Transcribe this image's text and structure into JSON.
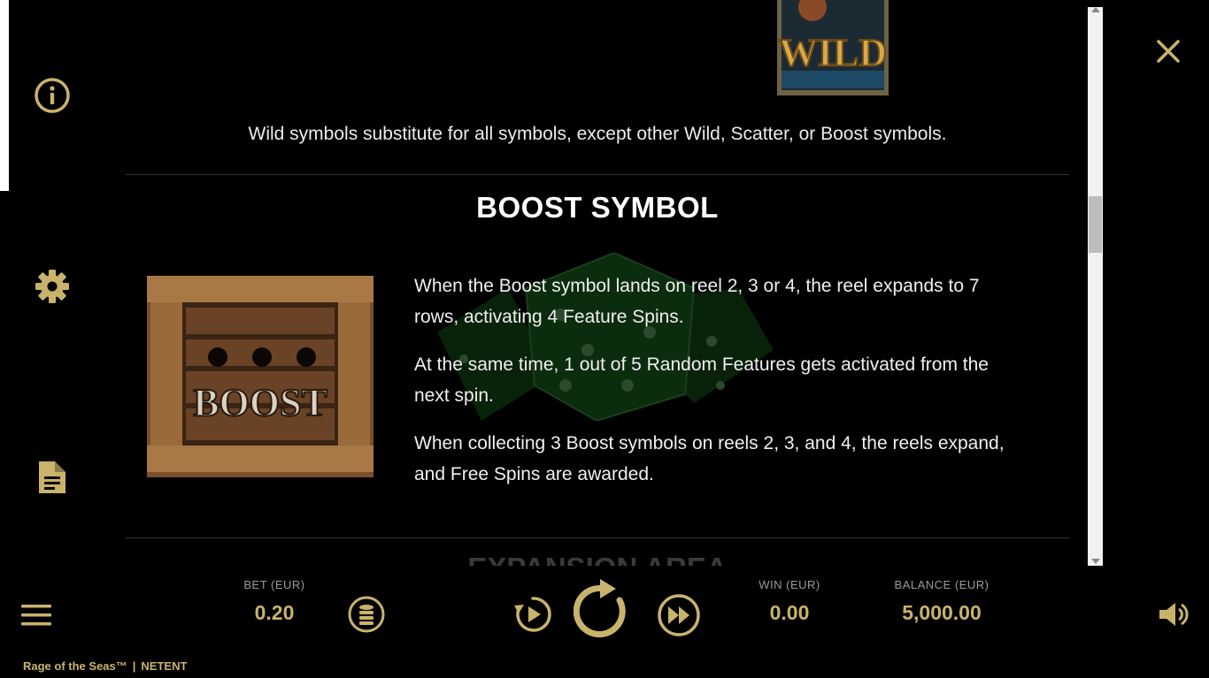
{
  "help": {
    "wild_image_text": "WILD",
    "wild_description": "Wild symbols substitute for all symbols, except other Wild, Scatter, or Boost symbols.",
    "boost_section": {
      "title": "BOOST SYMBOL",
      "image_text": "BOOST",
      "paragraphs": [
        "When the Boost symbol lands on reel 2, 3 or 4, the reel expands to 7 rows, activating 4 Feature Spins.",
        "At the same time, 1 out of 5 Random Features gets activated from the next spin.",
        "When collecting 3 Boost symbols on reels 2, 3, and 4, the reels expand, and Free Spins are awarded."
      ]
    },
    "next_section_title": "EXPANSION AREA"
  },
  "sidebar": {
    "items": [
      {
        "icon": "info-icon"
      },
      {
        "icon": "gear-icon"
      },
      {
        "icon": "document-icon"
      }
    ]
  },
  "bottom_bar": {
    "bet_label": "BET (EUR)",
    "bet_value": "0.20",
    "win_label": "WIN (EUR)",
    "win_value": "0.00",
    "balance_label": "BALANCE (EUR)",
    "balance_value": "5,000.00"
  },
  "brand": {
    "game_name": "Rage of the Seas™",
    "separator": "|",
    "provider": "NETENT"
  },
  "colors": {
    "accent": "#c9b36c",
    "background": "#000000"
  }
}
